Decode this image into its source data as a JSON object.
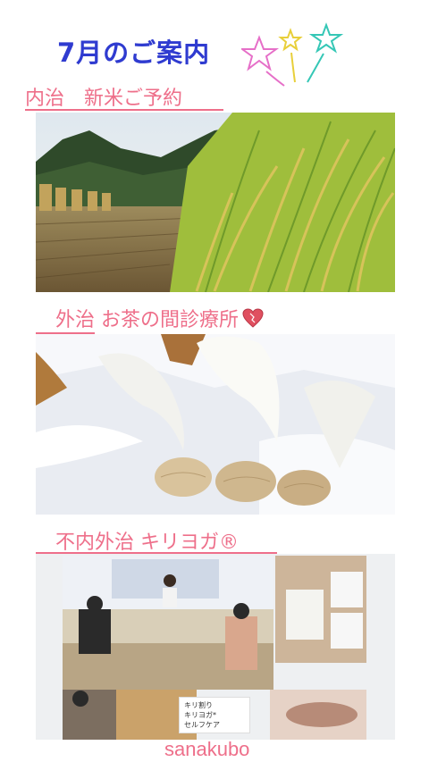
{
  "title": "7月のご案内",
  "sections": [
    {
      "label": "内治　新米ご予約"
    },
    {
      "label_underlined": "　外治",
      "label_rest": " お茶の間診療所"
    },
    {
      "label": "　不内外治 キリヨガ®"
    }
  ],
  "collage_note": {
    "line1": "キリ割り",
    "line2": "キリヨガ*",
    "line3": "セルフケア"
  },
  "credit": "sanakubo",
  "colors": {
    "title": "#2f3bd0",
    "accent": "#ee6f8a",
    "heart": "#e05060"
  },
  "icons": [
    "star-decoration-icon",
    "heart-icon"
  ]
}
